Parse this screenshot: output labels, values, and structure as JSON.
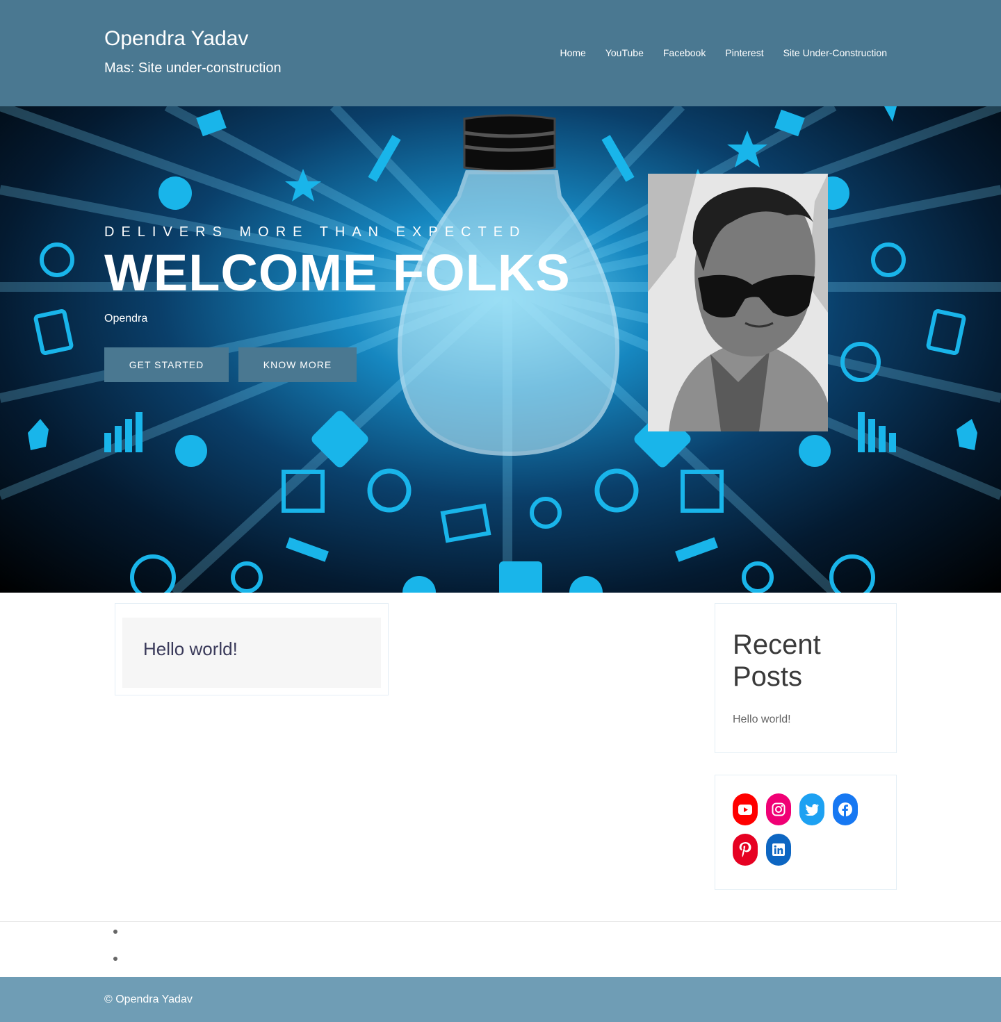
{
  "header": {
    "site_title": "Opendra Yadav",
    "tagline": "Mas: Site under-construction",
    "nav": [
      "Home",
      "YouTube",
      "Facebook",
      "Pinterest",
      "Site Under-Construction"
    ]
  },
  "hero": {
    "eyebrow": "DELIVERS MORE THAN EXPECTED",
    "title": "WELCOME FOLKS",
    "subtitle": "Opendra",
    "buttons": {
      "get_started": "GET STARTED",
      "know_more": "KNOW MORE"
    }
  },
  "posts": [
    {
      "title": "Hello world!"
    }
  ],
  "sidebar": {
    "recent_posts": {
      "heading": "Recent Posts",
      "items": [
        "Hello world!"
      ]
    },
    "social": [
      {
        "name": "youtube-icon",
        "color": "#ff0000"
      },
      {
        "name": "instagram-icon",
        "color": "#f00075"
      },
      {
        "name": "twitter-icon",
        "color": "#1da1f2"
      },
      {
        "name": "facebook-icon",
        "color": "#1778f2"
      },
      {
        "name": "pinterest-icon",
        "color": "#e60122"
      },
      {
        "name": "linkedin-icon",
        "color": "#0d66c2"
      }
    ]
  },
  "footer": {
    "copyright": "© Opendra Yadav"
  },
  "colors": {
    "header_bg": "#4a7891",
    "footer_bg": "#6f9db5",
    "hero_icon": "#19b5ea"
  }
}
